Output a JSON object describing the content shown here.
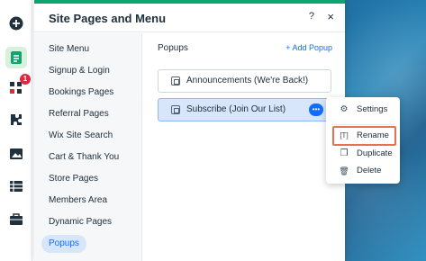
{
  "toolbar": {
    "items": [
      {
        "name": "add-icon",
        "glyph": "+"
      },
      {
        "name": "pages-icon",
        "glyph": "≡"
      },
      {
        "name": "apps-icon",
        "glyph": "▪"
      },
      {
        "name": "puzzle-icon",
        "glyph": "✚"
      },
      {
        "name": "media-icon",
        "glyph": "▣"
      },
      {
        "name": "table-icon",
        "glyph": "☰"
      },
      {
        "name": "briefcase-icon",
        "glyph": "▤"
      }
    ],
    "notification_count": "1",
    "active_color": "#d8f0dc"
  },
  "panel": {
    "title": "Site Pages and Menu",
    "help": "?",
    "close": "×"
  },
  "nav": {
    "items": [
      "Site Menu",
      "Signup & Login",
      "Bookings Pages",
      "Referral Pages",
      "Wix Site Search",
      "Cart & Thank You",
      "Store Pages",
      "Members Area",
      "Dynamic Pages",
      "Popups"
    ],
    "selected": "Popups"
  },
  "content": {
    "section_title": "Popups",
    "add_label": "+ Add Popup",
    "rows": [
      {
        "label": "Announcements (We're Back!)"
      },
      {
        "label": "Subscribe (Join Our List)"
      }
    ],
    "more": "•••"
  },
  "context_menu": {
    "items": [
      {
        "icon": "gear-icon",
        "glyph": "⚙",
        "label": "Settings"
      },
      {
        "icon": "rename-icon",
        "glyph": "[T]",
        "label": "Rename"
      },
      {
        "icon": "duplicate-icon",
        "glyph": "❐",
        "label": "Duplicate"
      },
      {
        "icon": "trash-icon",
        "glyph": "🗑",
        "label": "Delete"
      }
    ]
  },
  "colors": {
    "accent": "#116dff",
    "brand_green": "#11a36f",
    "highlight": "#e8714d",
    "selected_bg": "#d7e6fb"
  }
}
